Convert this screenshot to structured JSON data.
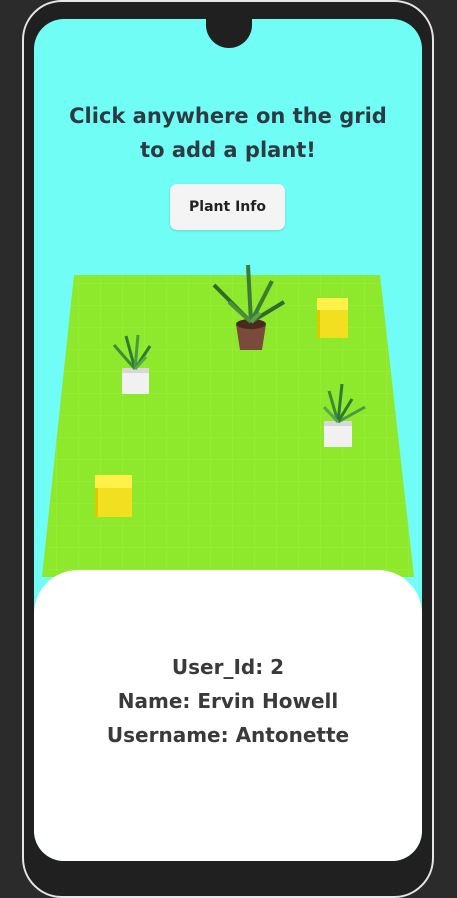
{
  "screen": {
    "title": "Click anywhere on the grid to add a plant!",
    "plant_info_button_label": "Plant Info",
    "colors": {
      "sky": "#6ffdf6",
      "grid": "#8ee82b",
      "card": "#ffffff",
      "cube": "#f7e629",
      "text": "#2e3a42"
    }
  },
  "user": {
    "user_id_line": "User_Id: 2",
    "name_line": "Name: Ervin Howell",
    "username_line": "Username: Antonette"
  }
}
